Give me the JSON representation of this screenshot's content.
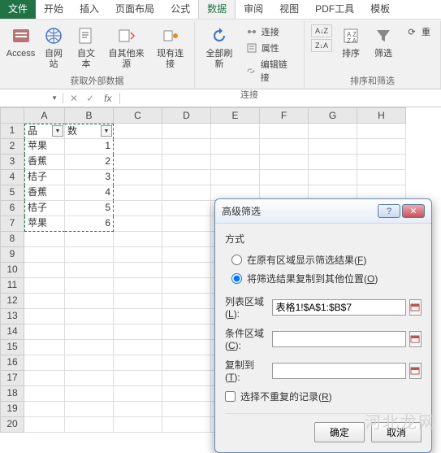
{
  "tabs": {
    "file": "文件",
    "start": "开始",
    "insert": "插入",
    "layout": "页面布局",
    "formula": "公式",
    "data": "数据",
    "review": "审阅",
    "view": "视图",
    "pdf": "PDF工具",
    "template": "模板"
  },
  "ribbon": {
    "access": "Access",
    "web": "自网站",
    "text": "自文本",
    "other": "自其他来源",
    "existing": "现有连接",
    "refresh": "全部刷新",
    "connections": "连接",
    "properties": "属性",
    "editlinks": "编辑链接",
    "sortaz": "A↓Z",
    "sortza": "Z↓A",
    "sort": "排序",
    "filter": "筛选",
    "reapply": "重",
    "group_external": "获取外部数据",
    "group_connections": "连接",
    "group_sort": "排序和筛选"
  },
  "formula_bar": {
    "fx": "fx"
  },
  "columns": [
    "A",
    "B",
    "C",
    "D",
    "E",
    "F",
    "G",
    "H"
  ],
  "sheet": {
    "a1": "品",
    "b1": "数",
    "rows": [
      {
        "a": "苹果",
        "b": "1"
      },
      {
        "a": "香蕉",
        "b": "2"
      },
      {
        "a": "桔子",
        "b": "3"
      },
      {
        "a": "香蕉",
        "b": "4"
      },
      {
        "a": "桔子",
        "b": "5"
      },
      {
        "a": "苹果",
        "b": "6"
      }
    ]
  },
  "dialog": {
    "title": "高级筛选",
    "method": "方式",
    "opt_inplace": "在原有区域显示筛选结果(",
    "opt_inplace_u": "F",
    "opt_copy": "将筛选结果复制到其他位置(",
    "opt_copy_u": "O",
    "list_range": "列表区域(",
    "list_range_u": "L",
    "criteria": "条件区域(",
    "criteria_u": "C",
    "copyto": "复制到(",
    "copyto_u": "T",
    "list_range_val": "表格1!$A$1:$B$7",
    "criteria_val": "",
    "copyto_val": "",
    "unique": "选择不重复的记录(",
    "unique_u": "R",
    "ok": "确定",
    "cancel": "取消"
  },
  "watermark": "河北龙网",
  "colors": {
    "accent": "#217346"
  }
}
